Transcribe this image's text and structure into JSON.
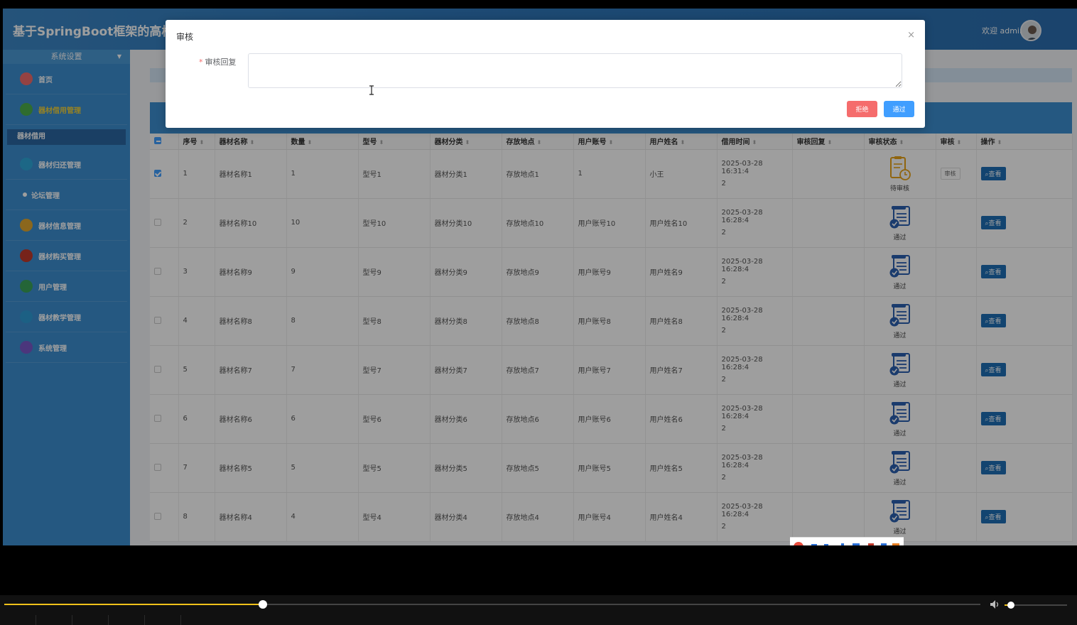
{
  "header": {
    "title": "基于SpringBoot框架的高校",
    "welcome": "欢迎 admin"
  },
  "sidebar": {
    "section": "系统设置",
    "items": [
      {
        "label": "首页",
        "icon": "home-icon",
        "color": "#ef6b6b"
      },
      {
        "label": "器材借用管理",
        "icon": "tools-icon",
        "color": "#4cae4c",
        "highlight": true
      },
      {
        "label": "器材借用",
        "sub": true
      },
      {
        "label": "器材归还管理",
        "icon": "return-icon",
        "color": "#2ea6d8"
      },
      {
        "label": "论坛管理",
        "icon": "dot-icon",
        "dot": true
      },
      {
        "label": "器材信息管理",
        "icon": "info-icon",
        "color": "#e0a630"
      },
      {
        "label": "器材购买管理",
        "icon": "cart-icon",
        "color": "#c0392b"
      },
      {
        "label": "用户管理",
        "icon": "user-icon",
        "color": "#3aa35a"
      },
      {
        "label": "器材教学管理",
        "icon": "teach-icon",
        "color": "#2e9bd6"
      },
      {
        "label": "系统管理",
        "icon": "system-icon",
        "color": "#7a57c8"
      }
    ]
  },
  "table": {
    "columns": [
      "序号",
      "器材名称",
      "数量",
      "型号",
      "器材分类",
      "存放地点",
      "用户账号",
      "用户姓名",
      "借用时间",
      "审核回复",
      "审核状态",
      "审核",
      "操作"
    ],
    "rows": [
      {
        "no": "1",
        "name": "器材名称1",
        "qty": "1",
        "model": "型号1",
        "category": "器材分类1",
        "place": "存放地点1",
        "account": "1",
        "uname": "小王",
        "time1": "2025-03-28 16:31:4",
        "time2": "2",
        "reply": "",
        "status": "待审核",
        "pending": true,
        "checked": true
      },
      {
        "no": "2",
        "name": "器材名称10",
        "qty": "10",
        "model": "型号10",
        "category": "器材分类10",
        "place": "存放地点10",
        "account": "用户账号10",
        "uname": "用户姓名10",
        "time1": "2025-03-28 16:28:4",
        "time2": "2",
        "reply": "",
        "status": "通过"
      },
      {
        "no": "3",
        "name": "器材名称9",
        "qty": "9",
        "model": "型号9",
        "category": "器材分类9",
        "place": "存放地点9",
        "account": "用户账号9",
        "uname": "用户姓名9",
        "time1": "2025-03-28 16:28:4",
        "time2": "2",
        "reply": "",
        "status": "通过"
      },
      {
        "no": "4",
        "name": "器材名称8",
        "qty": "8",
        "model": "型号8",
        "category": "器材分类8",
        "place": "存放地点8",
        "account": "用户账号8",
        "uname": "用户姓名8",
        "time1": "2025-03-28 16:28:4",
        "time2": "2",
        "reply": "",
        "status": "通过"
      },
      {
        "no": "5",
        "name": "器材名称7",
        "qty": "7",
        "model": "型号7",
        "category": "器材分类7",
        "place": "存放地点7",
        "account": "用户账号7",
        "uname": "用户姓名7",
        "time1": "2025-03-28 16:28:4",
        "time2": "2",
        "reply": "",
        "status": "通过"
      },
      {
        "no": "6",
        "name": "器材名称6",
        "qty": "6",
        "model": "型号6",
        "category": "器材分类6",
        "place": "存放地点6",
        "account": "用户账号6",
        "uname": "用户姓名6",
        "time1": "2025-03-28 16:28:4",
        "time2": "2",
        "reply": "",
        "status": "通过"
      },
      {
        "no": "7",
        "name": "器材名称5",
        "qty": "5",
        "model": "型号5",
        "category": "器材分类5",
        "place": "存放地点5",
        "account": "用户账号5",
        "uname": "用户姓名5",
        "time1": "2025-03-28 16:28:4",
        "time2": "2",
        "reply": "",
        "status": "通过"
      },
      {
        "no": "8",
        "name": "器材名称4",
        "qty": "4",
        "model": "型号4",
        "category": "器材分类4",
        "place": "存放地点4",
        "account": "用户账号4",
        "uname": "用户姓名4",
        "time1": "2025-03-28 16:28:4",
        "time2": "2",
        "reply": "",
        "status": "通过"
      }
    ],
    "review_btn": "审核",
    "view_btn": "查看"
  },
  "dialog": {
    "title": "审核",
    "field_label": "审核回复",
    "field_value": "",
    "reject": "拒绝",
    "pass": "通过",
    "close": "×"
  },
  "player": {
    "progress": 0.265,
    "volume": 0.1
  },
  "colors": {
    "accent": "#409eff",
    "danger": "#f56c6c",
    "sidebar": "#3d8ed0",
    "header": "#2f78bb"
  }
}
